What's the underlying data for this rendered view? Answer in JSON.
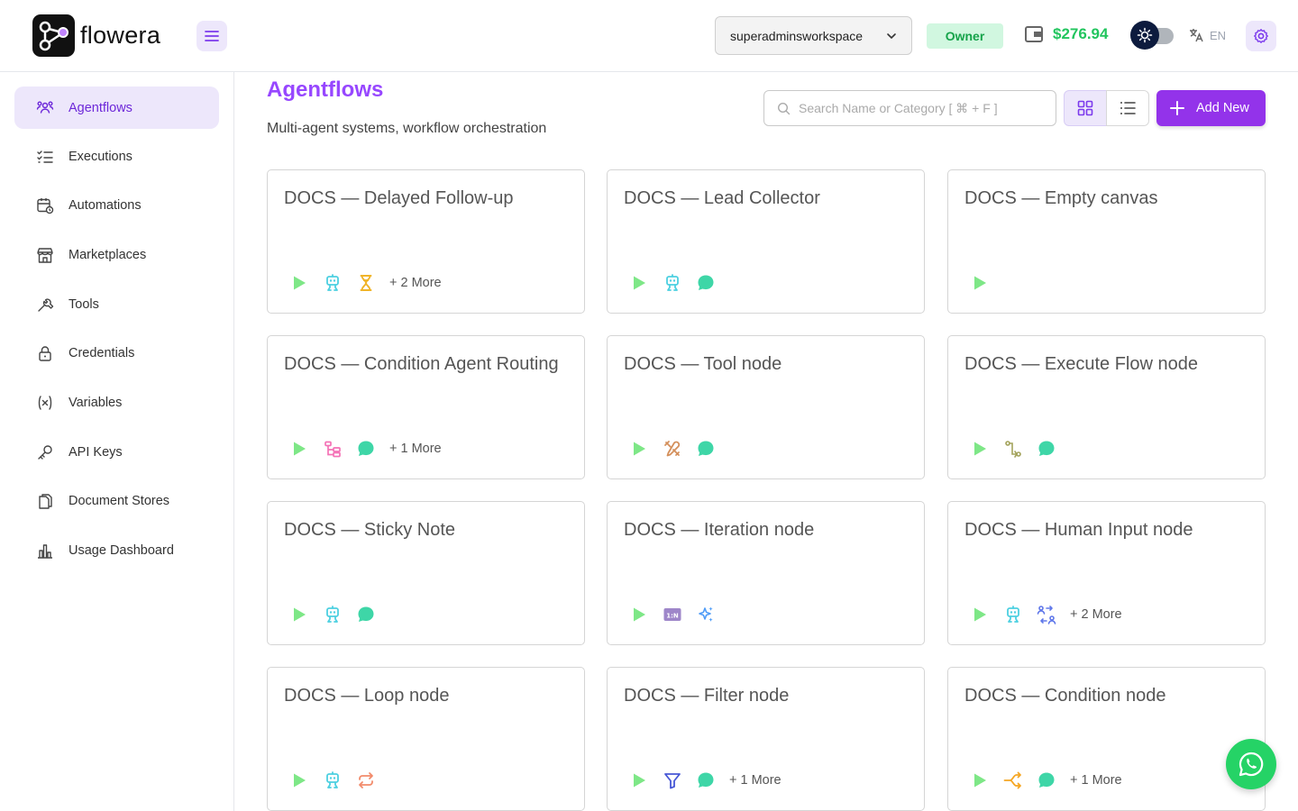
{
  "app": {
    "brand": "flowera"
  },
  "header": {
    "workspace": "superadminsworkspace",
    "role_badge": "Owner",
    "balance": "$276.94",
    "language": "EN"
  },
  "sidebar": {
    "items": [
      {
        "label": "Agentflows",
        "icon": "agents-icon",
        "active": true
      },
      {
        "label": "Executions",
        "icon": "checklist-icon"
      },
      {
        "label": "Automations",
        "icon": "calendar-clock-icon"
      },
      {
        "label": "Marketplaces",
        "icon": "store-icon"
      },
      {
        "label": "Tools",
        "icon": "wrench-icon"
      },
      {
        "label": "Credentials",
        "icon": "lock-icon"
      },
      {
        "label": "Variables",
        "icon": "variable-icon"
      },
      {
        "label": "API Keys",
        "icon": "key-icon"
      },
      {
        "label": "Document Stores",
        "icon": "documents-icon"
      },
      {
        "label": "Usage Dashboard",
        "icon": "bar-chart-icon"
      }
    ]
  },
  "page": {
    "title": "Agentflows",
    "subtitle": "Multi-agent systems, workflow orchestration",
    "search_placeholder": "Search Name or Category [ ⌘ + F ]",
    "add_button": "Add New"
  },
  "flows": [
    {
      "title": "DOCS — Delayed Follow-up",
      "icons": [
        "start-icon",
        "agent-icon",
        "hourglass-icon"
      ],
      "more": "+ 2 More"
    },
    {
      "title": "DOCS — Lead Collector",
      "icons": [
        "start-icon",
        "agent-icon",
        "llm-chat-icon"
      ],
      "more": ""
    },
    {
      "title": "DOCS — Empty canvas",
      "icons": [
        "start-icon"
      ],
      "more": ""
    },
    {
      "title": "DOCS — Condition Agent Routing",
      "icons": [
        "start-icon",
        "condition-agent-icon",
        "llm-chat-icon"
      ],
      "more": "+ 1 More"
    },
    {
      "title": "DOCS — Tool node",
      "icons": [
        "start-icon",
        "tool-icon",
        "llm-chat-icon"
      ],
      "more": ""
    },
    {
      "title": "DOCS — Execute Flow node",
      "icons": [
        "start-icon",
        "execute-flow-icon",
        "llm-chat-icon"
      ],
      "more": ""
    },
    {
      "title": "DOCS — Sticky Note",
      "icons": [
        "start-icon",
        "agent-icon",
        "llm-chat-icon"
      ],
      "more": ""
    },
    {
      "title": "DOCS — Iteration node",
      "icons": [
        "start-icon",
        "iteration-icon",
        "sparkles-icon"
      ],
      "more": ""
    },
    {
      "title": "DOCS — Human Input node",
      "icons": [
        "start-icon",
        "agent-icon",
        "human-input-icon"
      ],
      "more": "+ 2 More"
    },
    {
      "title": "DOCS — Loop node",
      "icons": [
        "start-icon",
        "agent-icon",
        "loop-icon"
      ],
      "more": ""
    },
    {
      "title": "DOCS — Filter node",
      "icons": [
        "start-icon",
        "filter-icon",
        "llm-chat-icon"
      ],
      "more": "+ 1 More"
    },
    {
      "title": "DOCS — Condition node",
      "icons": [
        "start-icon",
        "condition-icon",
        "llm-chat-icon"
      ],
      "more": "+ 1 More"
    }
  ],
  "colors": {
    "accent": "#9333ea",
    "title": "#9747ff",
    "active_bg": "#ede7fb",
    "balance": "#22c55e",
    "start": "#7ee787",
    "agent": "#4dd0e1",
    "chat": "#3ed6a7"
  }
}
